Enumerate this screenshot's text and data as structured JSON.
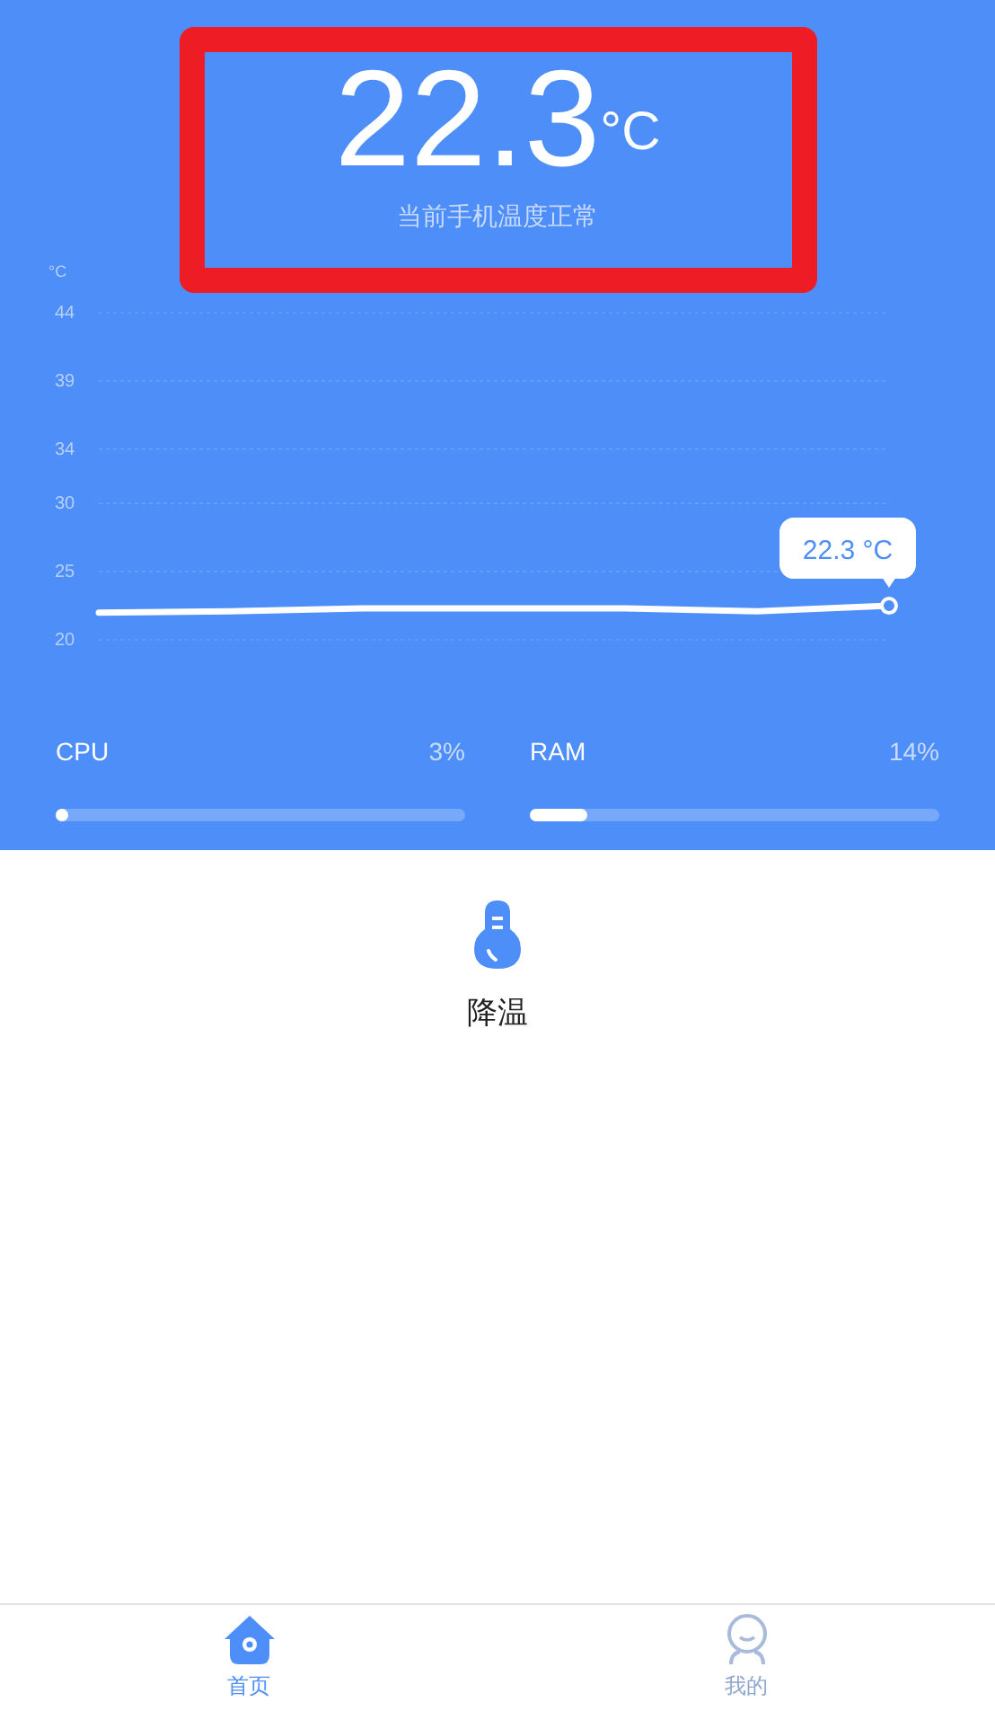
{
  "header": {
    "temperature": "22.3",
    "unit": "°C",
    "status": "当前手机温度正常",
    "highlight_frame": true
  },
  "chart": {
    "unit_label": "°C",
    "chart_data": {
      "type": "line",
      "grid": true,
      "ylim": [
        20,
        44
      ],
      "yticks": [
        20,
        25,
        30,
        34,
        39,
        44
      ],
      "series": [
        {
          "color": "#ffffff",
          "values": [
            22.0,
            22.1,
            22.3,
            22.3,
            22.3,
            22.1,
            22.5
          ]
        }
      ],
      "annotations": [
        "22.3 °C"
      ]
    }
  },
  "meters": [
    {
      "label": "CPU",
      "reading": "3%",
      "level": 0.03
    },
    {
      "label": "RAM",
      "reading": "14%",
      "level": 0.14
    }
  ],
  "action": {
    "label": "降温"
  },
  "tabs": [
    {
      "label": "首页",
      "kind": "home",
      "selected": true
    },
    {
      "label": "我的",
      "kind": "profile",
      "selected": false
    }
  ]
}
